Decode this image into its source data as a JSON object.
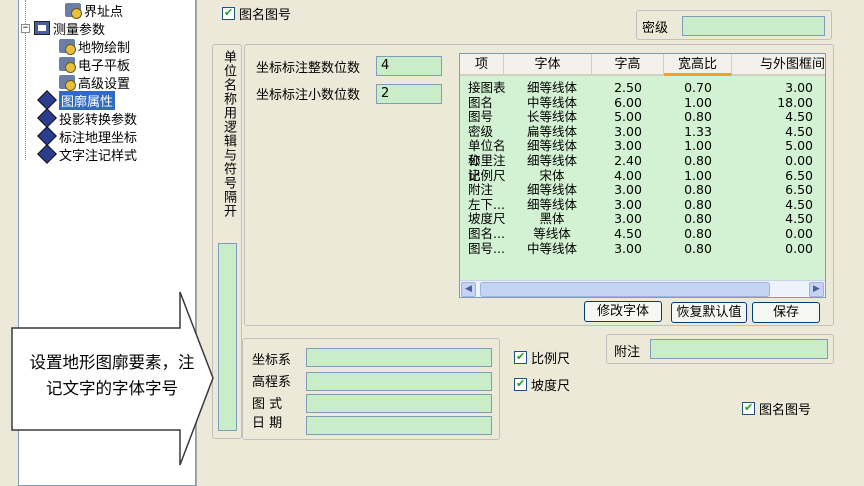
{
  "tree": {
    "items": [
      {
        "label": "界址点",
        "icon": "gear-icon"
      },
      {
        "label": "测量参数",
        "icon": "book-icon",
        "expander": "−"
      },
      {
        "label": "地物绘制",
        "icon": "gear-icon"
      },
      {
        "label": "电子平板",
        "icon": "gear-icon"
      },
      {
        "label": "高级设置",
        "icon": "gear-icon"
      },
      {
        "label": "图廓属性",
        "icon": "diamond-icon"
      },
      {
        "label": "投影转换参数",
        "icon": "diamond-icon"
      },
      {
        "label": "标注地理坐标",
        "icon": "diamond-icon"
      },
      {
        "label": "文字注记样式",
        "icon": "diamond-icon"
      }
    ]
  },
  "main": {
    "top_checkbox_label": "图名图号",
    "secret_label": "密级",
    "vertical_label": "单位名称用逻辑与符号隔开",
    "coord_int_label": "坐标标注整数位数",
    "coord_int_value": "4",
    "coord_dec_label": "坐标标注小数位数",
    "coord_dec_value": "2",
    "grid": {
      "columns": [
        "项",
        "字体",
        "字高",
        "宽高比",
        "与外图框间"
      ],
      "rows": [
        [
          "接图表",
          "细等线体",
          "2.50",
          "0.70",
          "3.00"
        ],
        [
          "图名",
          "中等线体",
          "6.00",
          "1.00",
          "18.00"
        ],
        [
          "图号",
          "长等线体",
          "5.00",
          "0.80",
          "4.50"
        ],
        [
          "密级",
          "扁等线体",
          "3.00",
          "1.33",
          "4.50"
        ],
        [
          "单位名称",
          "细等线体",
          "3.00",
          "1.00",
          "5.00"
        ],
        [
          "公里注记",
          "细等线体",
          "2.40",
          "0.80",
          "0.00"
        ],
        [
          "比例尺",
          "宋体",
          "4.00",
          "1.00",
          "6.50"
        ],
        [
          "附注",
          "细等线体",
          "3.00",
          "0.80",
          "6.50"
        ],
        [
          "左下...",
          "细等线体",
          "3.00",
          "0.80",
          "4.50"
        ],
        [
          "坡度尺",
          "黑体",
          "3.00",
          "0.80",
          "4.50"
        ],
        [
          "图名...",
          "等线体",
          "4.50",
          "0.80",
          "0.00"
        ],
        [
          "图号...",
          "中等线体",
          "3.00",
          "0.80",
          "0.00"
        ]
      ]
    },
    "buttons": {
      "modify_font": "修改字体",
      "restore_default": "恢复默认值",
      "save": "保存"
    },
    "left_fields": [
      "坐标系",
      "高程系",
      "图 式",
      "日 期"
    ],
    "scale_label": "比例尺",
    "slope_label": "坡度尺",
    "note_label": "附注",
    "bottom_checkbox_label": "图名图号"
  },
  "callout": {
    "text": "设置地形图廓要素，注记文字的字体字号"
  }
}
